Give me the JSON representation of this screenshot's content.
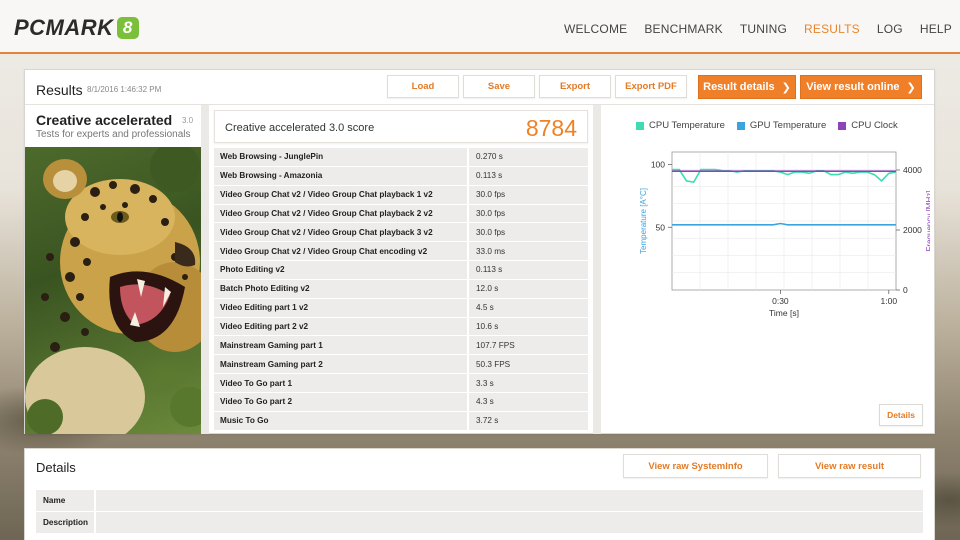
{
  "app": {
    "logo_text": "PCMARK",
    "logo_badge": "8"
  },
  "nav": {
    "items": [
      {
        "label": "WELCOME",
        "active": false
      },
      {
        "label": "BENCHMARK",
        "active": false
      },
      {
        "label": "TUNING",
        "active": false
      },
      {
        "label": "RESULTS",
        "active": true
      },
      {
        "label": "LOG",
        "active": false
      },
      {
        "label": "HELP",
        "active": false
      }
    ]
  },
  "results": {
    "title": "Results",
    "date": "8/1/2016 1:46:32 PM",
    "buttons": {
      "load": "Load",
      "save": "Save",
      "export": "Export",
      "export_pdf": "Export PDF",
      "result_details": "Result details",
      "view_online": "View result online"
    }
  },
  "test": {
    "name": "Creative accelerated",
    "version": "3.0",
    "description": "Tests for experts and professionals",
    "image_icon": "leopard-image"
  },
  "score": {
    "label": "Creative accelerated 3.0 score",
    "value": "8784"
  },
  "table": {
    "rows": [
      {
        "name": "Web Browsing - JunglePin",
        "value": "0.270 s"
      },
      {
        "name": "Web Browsing - Amazonia",
        "value": "0.113 s"
      },
      {
        "name": "Video Group Chat v2 / Video Group Chat playback 1 v2",
        "value": "30.0 fps"
      },
      {
        "name": "Video Group Chat v2 / Video Group Chat playback 2 v2",
        "value": "30.0 fps"
      },
      {
        "name": "Video Group Chat v2 / Video Group Chat playback 3 v2",
        "value": "30.0 fps"
      },
      {
        "name": "Video Group Chat v2 / Video Group Chat encoding v2",
        "value": "33.0 ms"
      },
      {
        "name": "Photo Editing v2",
        "value": "0.113 s"
      },
      {
        "name": "Batch Photo Editing v2",
        "value": "12.0 s"
      },
      {
        "name": "Video Editing part 1 v2",
        "value": "4.5 s"
      },
      {
        "name": "Video Editing part 2 v2",
        "value": "10.6 s"
      },
      {
        "name": "Mainstream Gaming part 1",
        "value": "107.7 FPS"
      },
      {
        "name": "Mainstream Gaming part 2",
        "value": "50.3 FPS"
      },
      {
        "name": "Video To Go part 1",
        "value": "3.3 s"
      },
      {
        "name": "Video To Go part 2",
        "value": "4.3 s"
      },
      {
        "name": "Music To Go",
        "value": "3.72 s"
      }
    ]
  },
  "chart": {
    "details_label": "Details",
    "legend": [
      {
        "name": "CPU Temperature",
        "color": "#3fdcb4"
      },
      {
        "name": "GPU Temperature",
        "color": "#3aa3e0"
      },
      {
        "name": "CPU Clock",
        "color": "#8e44b8"
      }
    ],
    "ylabel_left": "Temperature [A°C]",
    "ylabel_right": "Frequency [MHz]",
    "xlabel": "Time [s]",
    "left_ticks": [
      "100",
      "50"
    ],
    "right_ticks": [
      "4000",
      "2000",
      "0"
    ],
    "x_ticks": [
      "0:30",
      "1:00"
    ]
  },
  "chart_data": {
    "type": "line",
    "x": [
      0,
      2,
      4,
      6,
      8,
      10,
      12,
      14,
      16,
      18,
      20,
      22,
      24,
      26,
      28,
      30,
      32,
      34,
      36,
      38,
      40,
      42,
      44,
      46,
      48,
      50,
      52,
      54,
      56,
      58,
      60,
      62
    ],
    "xlim": [
      0,
      62
    ],
    "x_tick_labels": [
      "0:30",
      "1:00"
    ],
    "xlabel": "Time [s]",
    "ylabel": "Temperature [A°C]",
    "ylim": [
      0,
      110
    ],
    "y2label": "Frequency [MHz]",
    "y2lim": [
      0,
      4600
    ],
    "series": [
      {
        "name": "CPU Temperature",
        "axis": "left",
        "color": "#3fdcb4",
        "values": [
          96,
          96,
          87,
          86,
          96,
          96,
          96,
          95,
          95,
          94,
          95,
          95,
          95,
          95,
          95,
          94,
          92,
          94,
          94,
          93,
          95,
          95,
          92,
          92,
          94,
          93,
          94,
          94,
          92,
          87,
          93,
          94
        ]
      },
      {
        "name": "GPU Temperature",
        "axis": "left",
        "color": "#3aa3e0",
        "values": [
          52,
          52,
          52,
          52,
          52,
          52,
          52,
          52,
          52,
          52,
          52,
          52,
          52,
          52,
          52,
          53,
          52,
          52,
          52,
          52,
          52,
          52,
          52,
          52,
          52,
          52,
          52,
          52,
          52,
          52,
          52,
          52
        ]
      },
      {
        "name": "CPU Clock",
        "axis": "right",
        "color": "#8e44b8",
        "values": [
          3960,
          3960,
          3960,
          3960,
          3960,
          3960,
          3960,
          3960,
          3960,
          3960,
          3960,
          3960,
          3960,
          3960,
          3960,
          3960,
          3960,
          3960,
          3960,
          3960,
          3960,
          3960,
          3960,
          3960,
          3960,
          3960,
          3960,
          3960,
          3960,
          3960,
          3960,
          3960
        ]
      }
    ],
    "grid": true
  },
  "details": {
    "title": "Details",
    "view_systeminfo": "View raw SystemInfo",
    "view_result": "View raw result",
    "rows": [
      {
        "key": "Name",
        "value": ""
      },
      {
        "key": "Description",
        "value": ""
      }
    ]
  }
}
